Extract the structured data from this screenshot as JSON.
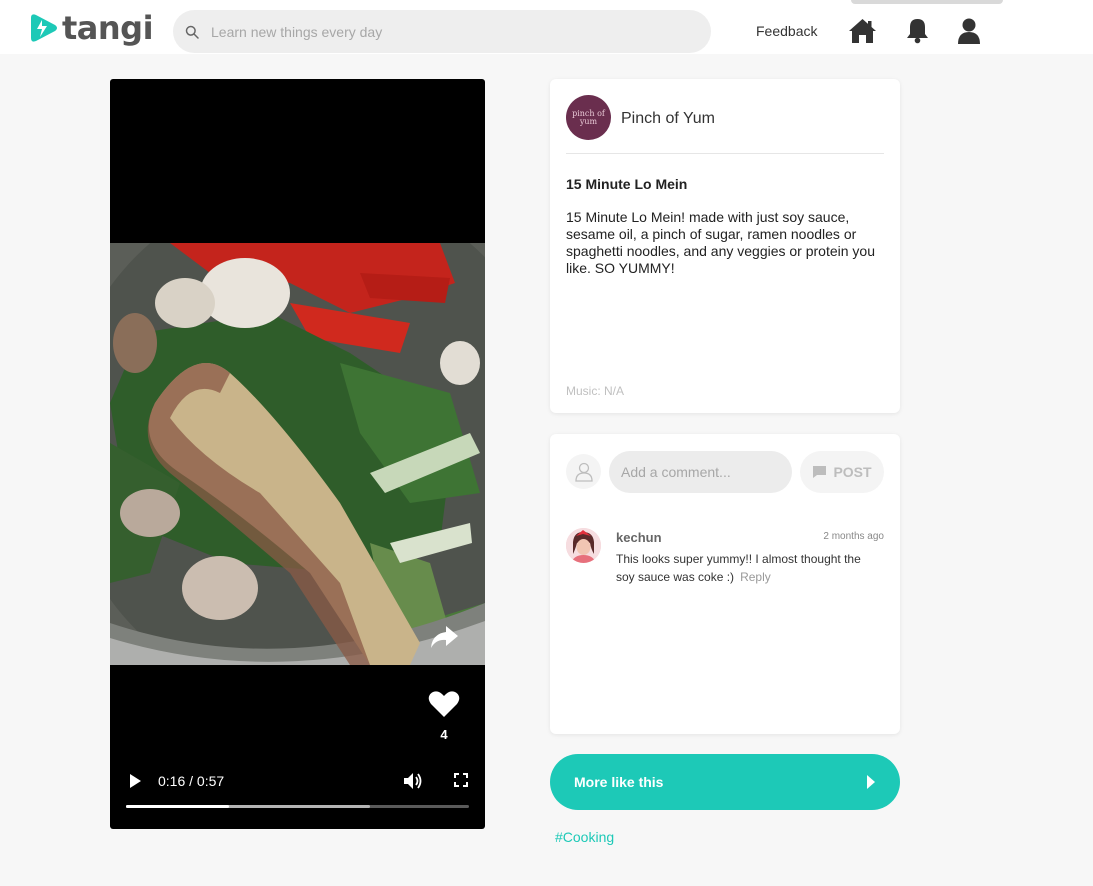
{
  "header": {
    "logo_text": "tangi",
    "search_placeholder": "Learn new things every day",
    "feedback_label": "Feedback",
    "nav_icons": [
      "home-icon",
      "bell-icon",
      "user-icon"
    ]
  },
  "video": {
    "likes": "4",
    "time_display": "0:16 / 0:57",
    "progress_played": 0.3,
    "progress_buffered": 0.71
  },
  "post": {
    "author": "Pinch of Yum",
    "author_avatar_text": "pinch of yum",
    "title": "15 Minute Lo Mein",
    "description": "15 Minute Lo Mein! made with just soy sauce, sesame oil, a pinch of sugar, ramen noodles or spaghetti noodles, and any veggies or protein you like. SO YUMMY!",
    "music": "Music: N/A"
  },
  "comments": {
    "input_placeholder": "Add a comment...",
    "post_label": "POST",
    "items": [
      {
        "user": "kechun",
        "time": "2 months ago",
        "text": "This looks super yummy!! I almost thought the soy sauce was coke :)",
        "reply_label": "Reply"
      }
    ]
  },
  "more_like_this_label": "More like this",
  "tag": "#Cooking",
  "colors": {
    "accent": "#1dc9b7",
    "background": "#f7f7f7"
  }
}
